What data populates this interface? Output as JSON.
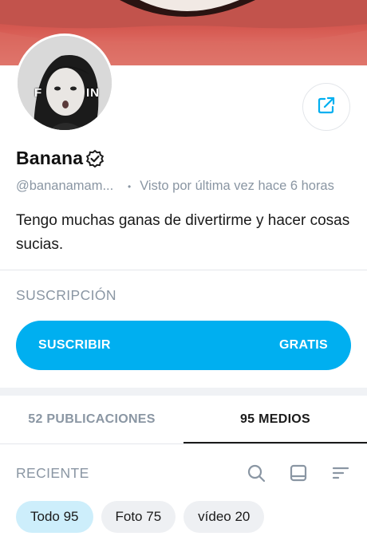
{
  "profile": {
    "name": "Banana",
    "handle": "@bananamam...",
    "separator": "•",
    "last_seen": "Visto por última vez hace 6 horas",
    "bio": "Tengo muchas ganas de divertirme y hacer cosas sucias.",
    "avatar_overlay_left": "F",
    "avatar_overlay_right": "IN"
  },
  "subscription": {
    "section_title": "SUSCRIPCIÓN",
    "button_label": "SUSCRIBIR",
    "price_label": "GRATIS"
  },
  "tabs": [
    {
      "label": "52 PUBLICACIONES",
      "active": false
    },
    {
      "label": "95 MEDIOS",
      "active": true
    }
  ],
  "filter": {
    "sort_label": "RECIENTE",
    "icons": [
      "search-icon",
      "layout-icon",
      "sort-icon"
    ]
  },
  "chips": [
    {
      "label": "Todo 95",
      "selected": true
    },
    {
      "label": "Foto 75",
      "selected": false
    },
    {
      "label": "vídeo 20",
      "selected": false
    }
  ],
  "colors": {
    "accent": "#00aff0",
    "muted_text": "#8a96a3",
    "chip_selected": "#cdeefb",
    "chip_default": "#eef0f3"
  }
}
